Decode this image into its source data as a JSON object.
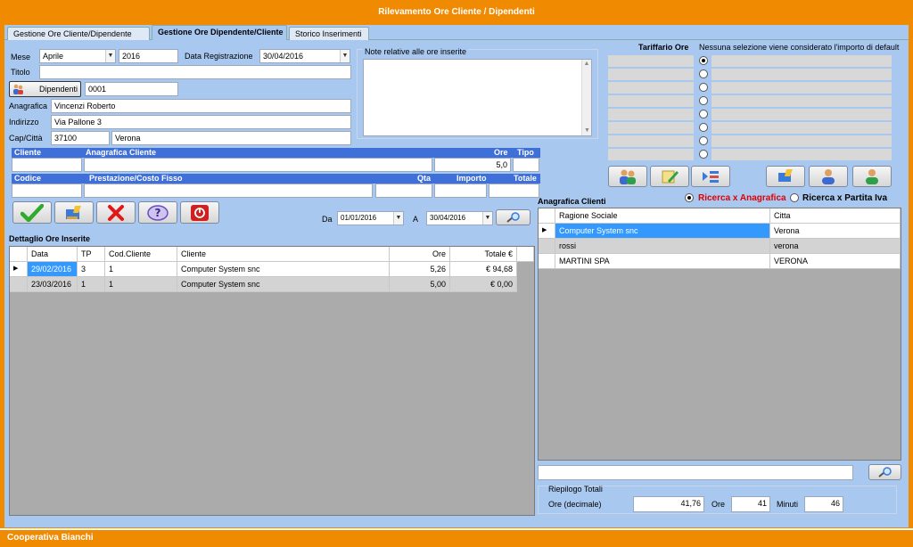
{
  "window": {
    "title": "Rilevamento Ore Cliente / Dipendenti",
    "status": "Cooperativa Bianchi"
  },
  "tabs": [
    {
      "label": "Gestione Ore Cliente/Dipendente"
    },
    {
      "label": "Gestione Ore Dipendente/Cliente"
    },
    {
      "label": "Storico Inserimenti"
    }
  ],
  "form": {
    "mese_label": "Mese",
    "mese_value": "Aprile",
    "anno_value": "2016",
    "data_reg_label": "Data Registrazione",
    "data_reg_value": "30/04/2016",
    "titolo_label": "Titolo",
    "titolo_value": "",
    "dipendenti_button": "Dipendenti",
    "dipendente_code": "0001",
    "anagrafica_label": "Anagrafica",
    "anagrafica_value": "Vincenzi Roberto",
    "indirizzo_label": "Indirizzo",
    "indirizzo_value": "Via Pallone 3",
    "capcitta_label": "Cap/Città",
    "cap_value": "37100",
    "citta_value": "Verona",
    "note_label": "Note relative alle ore inserite",
    "note_value": ""
  },
  "entry": {
    "h_cliente": "Cliente",
    "h_anagrafica_cliente": "Anagrafica Cliente",
    "h_ore": "Ore",
    "h_tipo": "Tipo",
    "cliente": "",
    "anagrafica_cliente": "",
    "ore": "5,0",
    "tipo": "",
    "h_codice": "Codice",
    "h_prestazione": "Prestazione/Costo Fisso",
    "h_qta": "Qta",
    "h_importo": "Importo",
    "h_totale": "Totale",
    "codice": "",
    "prestazione": "",
    "qta": "",
    "importo": "",
    "totale": ""
  },
  "filter": {
    "da_label": "Da",
    "da_value": "01/01/2016",
    "a_label": "A",
    "a_value": "30/04/2016"
  },
  "dettaglio": {
    "title": "Dettaglio Ore Inserite",
    "columns": [
      "Data",
      "TP",
      "Cod.Cliente",
      "Cliente",
      "Ore",
      "Totale €"
    ],
    "rows": [
      [
        "29/02/2016",
        "3",
        "1",
        "Computer System snc",
        "5,26",
        "€ 94,68"
      ],
      [
        "23/03/2016",
        "1",
        "1",
        "Computer System snc",
        "5,00",
        "€ 0,00"
      ]
    ]
  },
  "tariffario": {
    "title": "Tariffario Ore",
    "note": "Nessuna selezione viene considerato l'importo  di default"
  },
  "anagrafica_clienti": {
    "title": "Anagrafica Clienti",
    "search_anagrafica": "Ricerca x Anagrafica",
    "search_piva": "Ricerca x Partita Iva",
    "columns": [
      "Ragione Sociale",
      "Citta"
    ],
    "rows": [
      [
        "Computer System snc",
        "Verona"
      ],
      [
        "rossi",
        "verona"
      ],
      [
        "MARTINI SPA",
        "VERONA"
      ]
    ],
    "search_value": ""
  },
  "riepilogo": {
    "title": "Riepilogo Totali",
    "ore_dec_label": "Ore (decimale)",
    "ore_dec_value": "41,76",
    "ore_label": "Ore",
    "ore_value": "41",
    "minuti_label": "Minuti",
    "minuti_value": "46"
  },
  "colors": {
    "frame": "#F08A00",
    "panel": "#A9C8F0",
    "header_blue": "#3F6FD8",
    "selection": "#3399FF",
    "radio_red": "#E00000"
  }
}
